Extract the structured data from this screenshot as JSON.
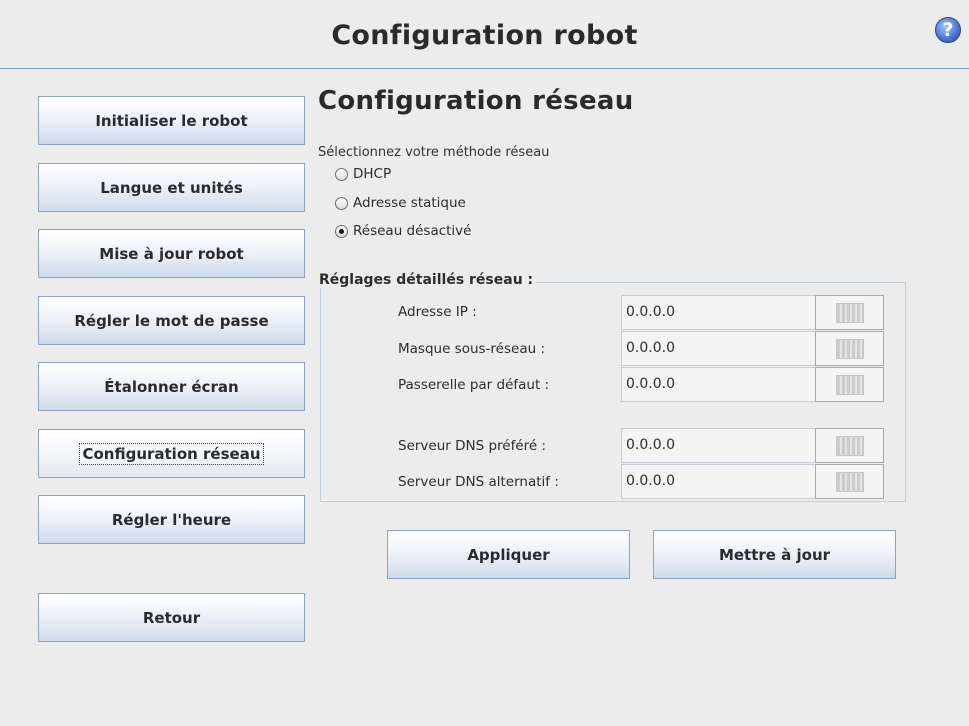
{
  "header": {
    "title": "Configuration robot",
    "help_symbol": "?"
  },
  "sidebar": {
    "items": [
      {
        "label": "Initialiser le robot"
      },
      {
        "label": "Langue et unités"
      },
      {
        "label": "Mise à jour robot"
      },
      {
        "label": "Régler le mot de passe"
      },
      {
        "label": "Étalonner écran"
      },
      {
        "label": "Configuration réseau",
        "active": true
      },
      {
        "label": "Régler l'heure"
      },
      {
        "label": "Retour"
      }
    ]
  },
  "main": {
    "title": "Configuration réseau",
    "method_prompt": "Sélectionnez votre méthode réseau",
    "methods": [
      {
        "label": "DHCP",
        "selected": false
      },
      {
        "label": "Adresse statique",
        "selected": false
      },
      {
        "label": "Réseau désactivé",
        "selected": true
      }
    ],
    "details": {
      "legend": "Réglages détaillés réseau :",
      "fields": [
        {
          "label": "Adresse IP :",
          "value": "0.0.0.0"
        },
        {
          "label": "Masque sous-réseau :",
          "value": "0.0.0.0"
        },
        {
          "label": "Passerelle par défaut :",
          "value": "0.0.0.0"
        },
        {
          "label": "Serveur DNS préféré :",
          "value": "0.0.0.0"
        },
        {
          "label": "Serveur DNS alternatif :",
          "value": "0.0.0.0"
        }
      ]
    },
    "buttons": {
      "apply": "Appliquer",
      "update": "Mettre à jour"
    }
  },
  "icons": {
    "help": "help-icon",
    "keypad": "keypad-icon"
  },
  "colors": {
    "background": "#ececec",
    "header_border": "#7e9cc2",
    "button_gradient_bottom": "#cfdbea",
    "help_icon": "#4d78d6"
  }
}
